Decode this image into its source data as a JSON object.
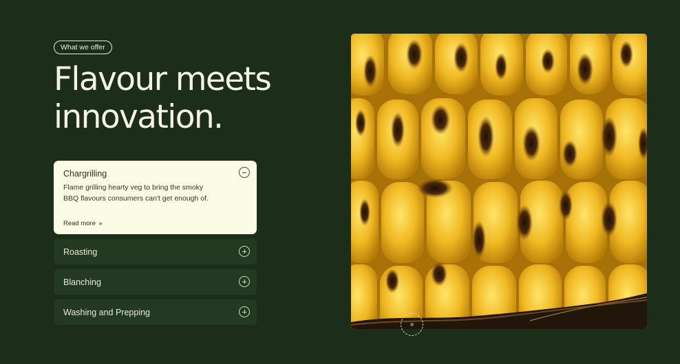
{
  "badge": {
    "label": "What we offer"
  },
  "headline": {
    "line1": "Flavour meets",
    "line2": "innovation."
  },
  "accordion": {
    "open": {
      "title": "Chargrilling",
      "description_line1": "Flame grilling hearty veg to bring the smoky",
      "description_line2": "BBQ flavours consumers can't get enough of.",
      "read_more": "Read more",
      "toggle_icon": "minus-icon"
    },
    "items": [
      {
        "title": "Roasting",
        "toggle_icon": "plus-icon"
      },
      {
        "title": "Blanching",
        "toggle_icon": "plus-icon"
      },
      {
        "title": "Washing and Prepping",
        "toggle_icon": "plus-icon"
      }
    ]
  },
  "media": {
    "subject": "grilled-corn-photo",
    "next_icon": "double-chevron-right-icon"
  },
  "colors": {
    "background": "#1c2e1a",
    "panel_open": "#fbfbe6",
    "panel_closed": "#243922",
    "text_light": "#f3f3e6",
    "corn_yellow": "#e7b21f",
    "char": "#2b1a0e"
  }
}
